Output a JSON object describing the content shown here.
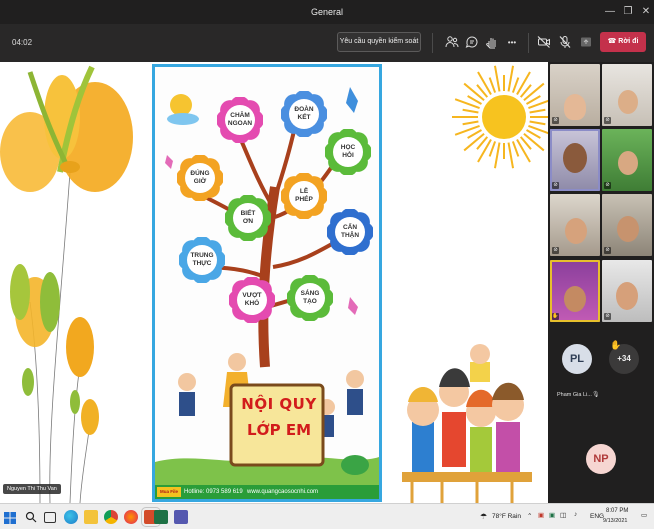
{
  "window": {
    "title": "General",
    "minimize": "—",
    "restore": "❐",
    "close": "✕"
  },
  "toolbar": {
    "timer": "04:02",
    "request_control_label": "Yêu cầu quyền kiểm soát",
    "more_label": "•••",
    "leave_label": "Rời đi"
  },
  "presenter": {
    "name": "Nguyen Thi Thu Van"
  },
  "poster": {
    "title_line1": "NỘI QUY",
    "title_line2": "LỚP EM",
    "flowers": [
      {
        "line1": "CHĂM",
        "line2": "NGOAN",
        "color": "#e44bb0"
      },
      {
        "line1": "ĐOÀN",
        "line2": "KẾT",
        "color": "#4a8fe0"
      },
      {
        "line1": "HỌC",
        "line2": "HỎI",
        "color": "#5bbb3a"
      },
      {
        "line1": "ĐÚNG",
        "line2": "GIỜ",
        "color": "#f3a322"
      },
      {
        "line1": "LỄ",
        "line2": "PHÉP",
        "color": "#f3a322"
      },
      {
        "line1": "BIẾT",
        "line2": "ƠN",
        "color": "#5bbb3a"
      },
      {
        "line1": "CẨN",
        "line2": "THẬN",
        "color": "#2f6fcf"
      },
      {
        "line1": "TRUNG",
        "line2": "THỰC",
        "color": "#4aa7e6"
      },
      {
        "line1": "VƯỢT",
        "line2": "KHÓ",
        "color": "#e44bb0"
      },
      {
        "line1": "SÁNG",
        "line2": "TẠO",
        "color": "#5bbb3a"
      }
    ],
    "hotline_badge": "Mua File",
    "hotline": "Hotline: 0973 589 619",
    "website": "www.quangcaosocnhi.com"
  },
  "participants": {
    "pl_initials": "PL",
    "pl_name": "Pham Gia Li...",
    "more_count": "+34",
    "np_initials": "NP"
  },
  "taskbar": {
    "weather": "78°F Rain",
    "language": "ENG",
    "time": "8:07 PM",
    "date": "9/13/2021"
  }
}
